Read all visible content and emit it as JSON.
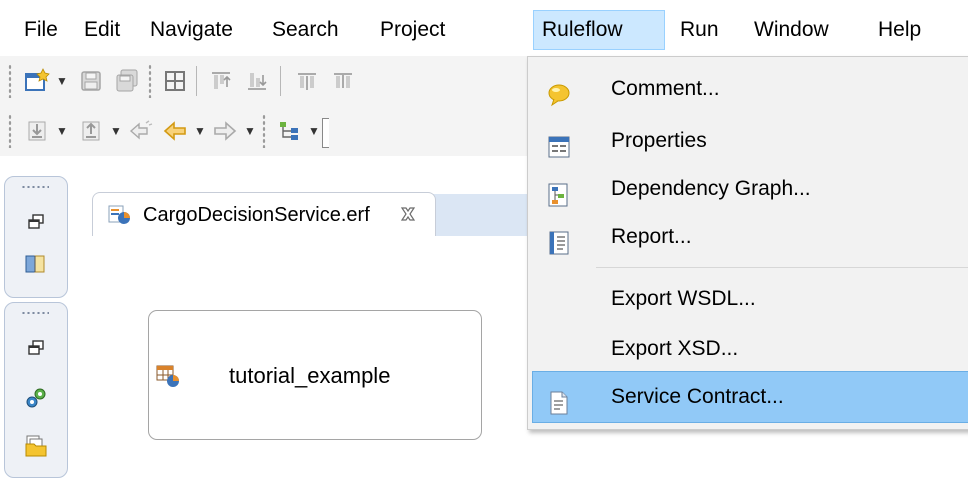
{
  "menubar": {
    "items": [
      {
        "label": "File"
      },
      {
        "label": "Edit"
      },
      {
        "label": "Navigate"
      },
      {
        "label": "Search"
      },
      {
        "label": "Project"
      },
      {
        "label": "Ruleflow"
      },
      {
        "label": "Run"
      },
      {
        "label": "Window"
      },
      {
        "label": "Help"
      }
    ],
    "open_item": "Ruleflow"
  },
  "toolbar1": {
    "icons": [
      "new-wizard-icon",
      "save-icon",
      "save-all-icon",
      "grid-icon",
      "align-top-icon",
      "align-bottom-icon",
      "distribute-icon",
      "distribute-alt-icon"
    ]
  },
  "toolbar2": {
    "icons": [
      "import-icon",
      "export-icon",
      "back-history-icon",
      "back-icon",
      "forward-icon",
      "ruleflow-diagram-icon"
    ]
  },
  "editor": {
    "tab_label": "CargoDecisionService.erf",
    "node_label": "tutorial_example"
  },
  "dropdown": {
    "items": [
      {
        "label": "Comment...",
        "icon": "comment-icon"
      },
      {
        "label": "Properties",
        "icon": "properties-icon"
      },
      {
        "label": "Dependency Graph...",
        "icon": "dependency-graph-icon"
      },
      {
        "label": "Report...",
        "icon": "report-icon"
      },
      {
        "label": "Export WSDL...",
        "icon": ""
      },
      {
        "label": "Export XSD...",
        "icon": ""
      },
      {
        "label": "Service Contract...",
        "icon": "service-contract-icon"
      }
    ],
    "highlighted": "Service Contract..."
  },
  "colors": {
    "menu_open_bg": "#cce8ff",
    "menu_highlight_bg": "#91c9f7",
    "trim_bg": "#eef1f6"
  }
}
